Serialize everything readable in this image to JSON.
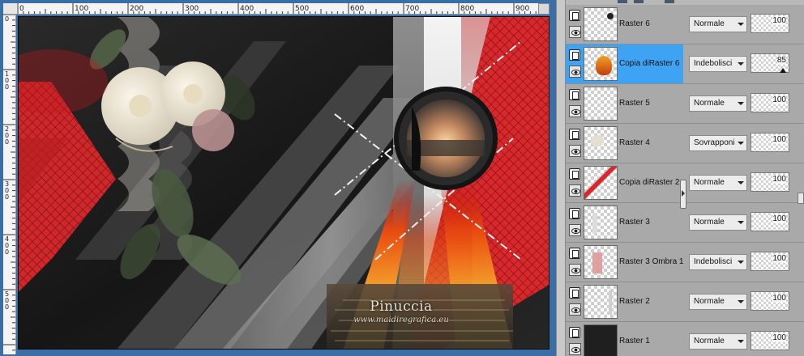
{
  "ruler": {
    "h_labels": [
      "0",
      "100",
      "200",
      "300",
      "400",
      "500",
      "600",
      "700",
      "800",
      "900"
    ],
    "v_labels": [
      "0",
      "100",
      "200",
      "300",
      "400",
      "500"
    ]
  },
  "watermark": {
    "name": "Pinuccia",
    "url": "www.maidiregrafica.eu"
  },
  "layers": [
    {
      "name": "Raster 6",
      "blend": "Normale",
      "opacity": 100,
      "selected": false,
      "thumb": "raster6-icon"
    },
    {
      "name": "Copia diRaster 6",
      "blend": "Indebolisci",
      "opacity": 85,
      "selected": true,
      "thumb": "copy-raster6-icon"
    },
    {
      "name": "Raster 5",
      "blend": "Normale",
      "opacity": 100,
      "selected": false,
      "thumb": "empty"
    },
    {
      "name": "Raster 4",
      "blend": "Sovrapponi",
      "opacity": 100,
      "selected": false,
      "thumb": "raster4-icon"
    },
    {
      "name": "Copia diRaster 2",
      "blend": "Normale",
      "opacity": 100,
      "selected": false,
      "thumb": "copy-raster2-icon"
    },
    {
      "name": "Raster 3",
      "blend": "Normale",
      "opacity": 100,
      "selected": false,
      "thumb": "raster3-icon"
    },
    {
      "name": "Raster 3 Ombra 1",
      "blend": "Indebolisci",
      "opacity": 100,
      "selected": false,
      "thumb": "shadow-icon"
    },
    {
      "name": "Raster 2",
      "blend": "Normale",
      "opacity": 100,
      "selected": false,
      "thumb": "raster2-icon"
    },
    {
      "name": "Raster 1",
      "blend": "Normale",
      "opacity": 100,
      "selected": false,
      "thumb": "dark-fill"
    }
  ],
  "colors": {
    "selection": "#3fa3f3",
    "panel_bg": "#a9a9a9",
    "canvas_frame": "#3b6ea5",
    "accent_red": "#d8282c"
  }
}
